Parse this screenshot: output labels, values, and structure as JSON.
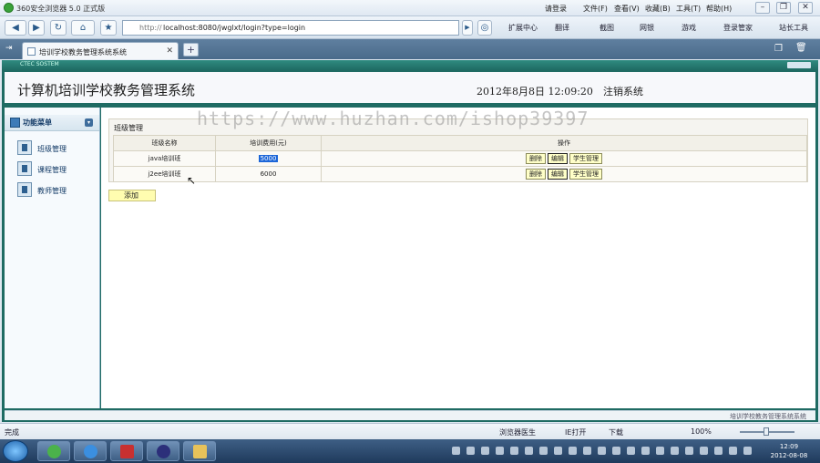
{
  "browser": {
    "title": "360安全浏览器 5.0 正式版",
    "login_label": "请登录",
    "menu": [
      "文件(F)",
      "查看(V)",
      "收藏(B)",
      "工具(T)",
      "帮助(H)"
    ],
    "address_prefix": "http://",
    "address_host": "localhost:8080/jwglxt/login?type=login",
    "tools": [
      "扩展中心",
      "翻译",
      "截图",
      "网银",
      "游戏",
      "登录管家",
      "站长工具"
    ],
    "tab_title": "培训学校教务管理系统系统",
    "status_left": "完成",
    "status_items": [
      "浏览器医生",
      "IE打开",
      "下载",
      "100%"
    ]
  },
  "app": {
    "frame_logo": "CTEC SOSTEM",
    "system_title": "计算机培训学校教务管理系统",
    "datetime": "2012年8月8日  12:09:20",
    "logout": "注销系统",
    "sidebar": {
      "header": "功能菜单",
      "items": [
        {
          "label": "班级管理"
        },
        {
          "label": "课程管理"
        },
        {
          "label": "教师管理"
        }
      ]
    },
    "panel_title": "班级管理",
    "table": {
      "headers": [
        "班级名称",
        "培训费用(元)",
        "操作"
      ],
      "rows": [
        {
          "name": "java培训班",
          "fee": "5000"
        },
        {
          "name": "j2ee培训班",
          "fee": "6000"
        }
      ],
      "actions": {
        "delete": "删除",
        "edit": "编辑",
        "students": "学生管理"
      }
    },
    "add_button": "添加",
    "footer": "培训学校教务管理系统系统"
  },
  "watermark": "https://www.huzhan.com/ishop39397",
  "taskbar": {
    "time": "12:09",
    "date": "2012-08-08"
  }
}
